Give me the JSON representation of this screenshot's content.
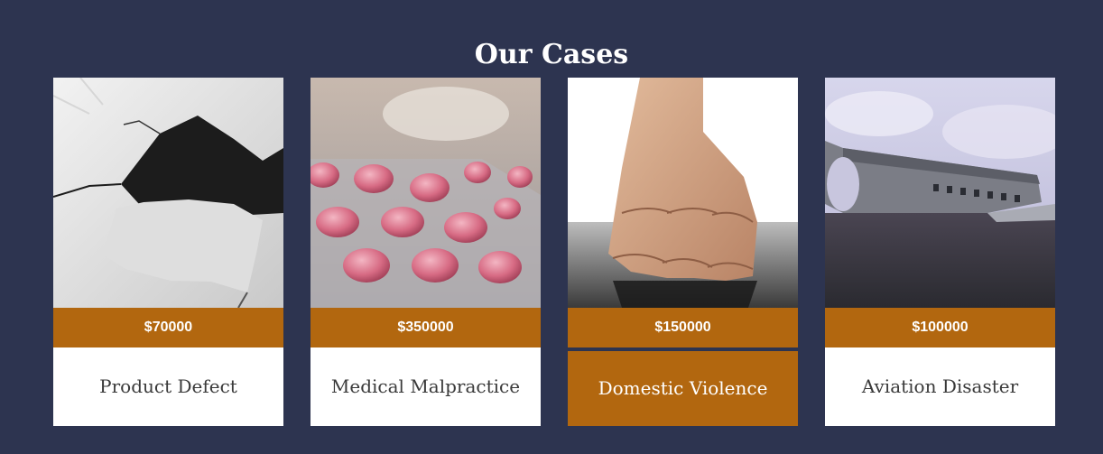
{
  "section": {
    "title": "Our Cases"
  },
  "colors": {
    "background": "#2d3450",
    "accent": "#b2670f",
    "card_text": "#3a3a3a"
  },
  "cases": [
    {
      "price": "$70000",
      "title": "Product Defect",
      "image": "cracked-wall-hole-photo"
    },
    {
      "price": "$350000",
      "title": "Medical Malpractice",
      "image": "pill-blister-pack-photo"
    },
    {
      "price": "$150000",
      "title": "Domestic Violence",
      "image": "clenched-fist-photo",
      "highlighted": true
    },
    {
      "price": "$100000",
      "title": "Aviation Disaster",
      "image": "wrecked-airplane-fuselage-photo"
    }
  ]
}
